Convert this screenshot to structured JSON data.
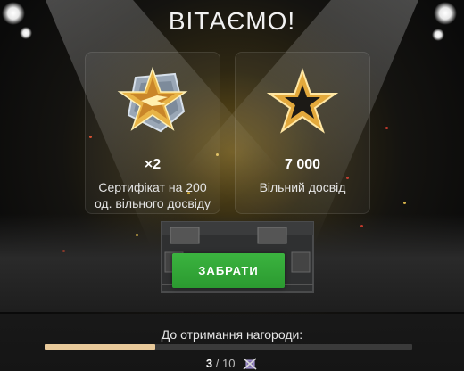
{
  "header": {
    "title": "ВІТАЄМО!"
  },
  "rewards": [
    {
      "icon": "silver-gold-star-medal-icon",
      "amount": "×2",
      "description": "Сертифікат на 200 од. вільного досвіду"
    },
    {
      "icon": "gold-star-icon",
      "amount": "7 000",
      "description": "Вільний досвід"
    }
  ],
  "actions": {
    "claim_label": "ЗАБРАТИ"
  },
  "progress": {
    "label": "До отримання нагороди:",
    "current": "3",
    "separator": "/",
    "total": "10",
    "fraction": 0.3,
    "badge_icon": "crossed-rewards-icon"
  },
  "colors": {
    "claim_button": "#2ea833",
    "progress_fill": "#e8c99a",
    "accent_gold": "#e6b84a"
  }
}
